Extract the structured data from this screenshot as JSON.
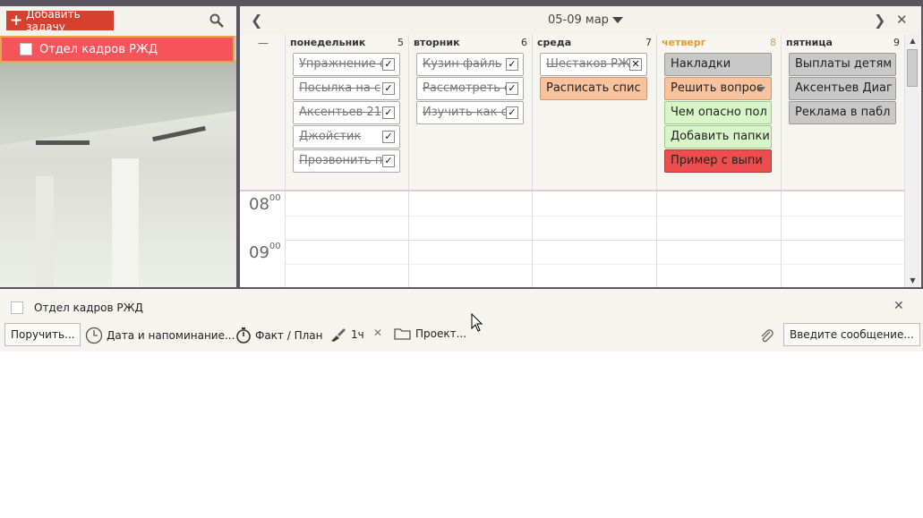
{
  "left_panel": {
    "add_task_label": "Добавить задачу",
    "project_name": "Отдел кадров РЖД"
  },
  "calendar": {
    "range_label": "05-09 мар",
    "collapse_label": "—",
    "days": [
      {
        "name": "понедельник",
        "num": "5",
        "today": false
      },
      {
        "name": "вторник",
        "num": "6",
        "today": false
      },
      {
        "name": "среда",
        "num": "7",
        "today": false
      },
      {
        "name": "четверг",
        "num": "8",
        "today": true
      },
      {
        "name": "пятница",
        "num": "9",
        "today": false
      }
    ],
    "tasks": {
      "mon": [
        {
          "title": "Упражнение с",
          "done": true
        },
        {
          "title": "Посылка на с",
          "done": true
        },
        {
          "title": "Аксентьев 21",
          "done": true
        },
        {
          "title": "Джойстик",
          "done": true
        },
        {
          "title": "Прозвонить п",
          "done": true
        }
      ],
      "tue": [
        {
          "title": "Кузин файль",
          "done": true
        },
        {
          "title": "Рассмотреть е",
          "done": true
        },
        {
          "title": "Изучить как с",
          "done": true
        }
      ],
      "wed": [
        {
          "title": "Шестаков РЖ",
          "done": true
        },
        {
          "title": "Расписать спис",
          "done": false
        }
      ],
      "thu": [
        {
          "title": "Накладки",
          "done": false
        },
        {
          "title": "Решить вопрос",
          "done": false
        },
        {
          "title": "Чем опасно пол",
          "done": false
        },
        {
          "title": "Добавить папки",
          "done": false
        },
        {
          "title": "Пример с выпи",
          "done": false
        }
      ],
      "fri": [
        {
          "title": "Выплаты детям",
          "done": false
        },
        {
          "title": "Аксентьев Диаг",
          "done": false
        },
        {
          "title": "Реклама в пабл",
          "done": false
        }
      ]
    },
    "hours": [
      {
        "h": "08",
        "m": "00"
      },
      {
        "h": "09",
        "m": "00"
      }
    ]
  },
  "task_panel": {
    "title": "Отдел кадров РЖД",
    "assign_label": "Поручить...",
    "date_label": "Дата и напоминание...",
    "fact_plan_label": "Факт / План",
    "duration_label": "1ч",
    "project_label": "Проект...",
    "message_label": "Введите сообщение..."
  },
  "colors": {
    "accent_red": "#d6402f",
    "project_row": "#f4545a",
    "today": "#e89a2a",
    "task_orange": "#f8c39c",
    "task_green": "#d8f5c8",
    "task_red": "#ee4d4e",
    "task_grey": "#c8c8c8"
  }
}
